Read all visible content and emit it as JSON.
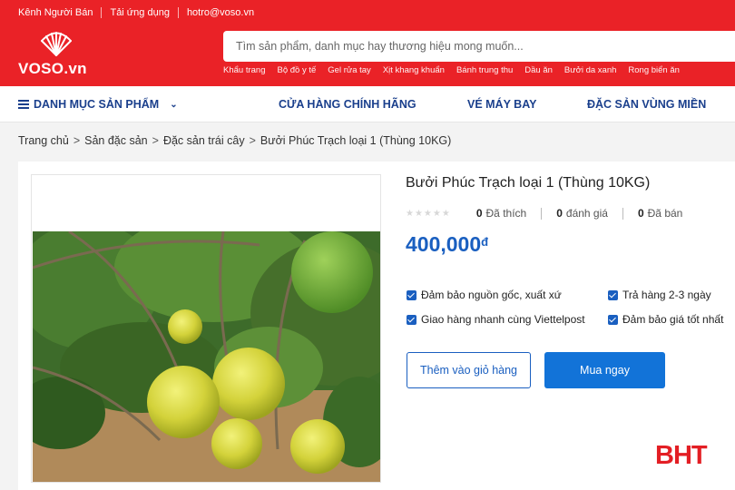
{
  "colors": {
    "brand_red": "#ea2227",
    "nav_blue": "#1a3f8c",
    "price_blue": "#1a5fc0",
    "button_blue": "#1273d8"
  },
  "top_links": [
    "Kênh Người Bán",
    "Tải ứng dụng",
    "hotro@voso.vn"
  ],
  "logo": {
    "text": "VOSO.vn",
    "icon": "shell-logo-icon"
  },
  "search": {
    "placeholder": "Tìm sản phẩm, danh mục hay thương hiệu mong muốn..."
  },
  "quick_links": [
    "Khẩu trang",
    "Bộ đồ y tế",
    "Gel rửa tay",
    "Xịt khang khuẩn",
    "Bánh trung thu",
    "Dầu ăn",
    "Bưởi da xanh",
    "Rong biển ăn"
  ],
  "category_nav": {
    "menu_label": "DANH MỤC SẢN PHẨM",
    "links": [
      "CỬA HÀNG CHÍNH HÃNG",
      "VÉ MÁY BAY",
      "ĐẶC SẢN VÙNG MIỀN"
    ]
  },
  "breadcrumb": [
    "Trang chủ",
    "Sản đặc sản",
    "Đặc sản trái cây",
    "Bưởi Phúc Trạch loại 1 (Thùng 10KG)"
  ],
  "product": {
    "title": "Bưởi Phúc Trạch loại 1 (Thùng 10KG)",
    "rating_stars": 0,
    "likes": "0",
    "likes_label": "Đã thích",
    "reviews": "0",
    "reviews_label": "đánh giá",
    "sold": "0",
    "sold_label": "Đã bán",
    "price": "400,000",
    "currency": "đ",
    "features": [
      "Đảm bảo nguồn gốc, xuất xứ",
      "Trả hàng 2-3 ngày",
      "Giao hàng nhanh cùng Viettelpost",
      "Đảm bảo giá tốt nhất"
    ],
    "add_to_cart": "Thêm vào giỏ hàng",
    "buy_now": "Mua ngay"
  },
  "watermark": "BHT"
}
